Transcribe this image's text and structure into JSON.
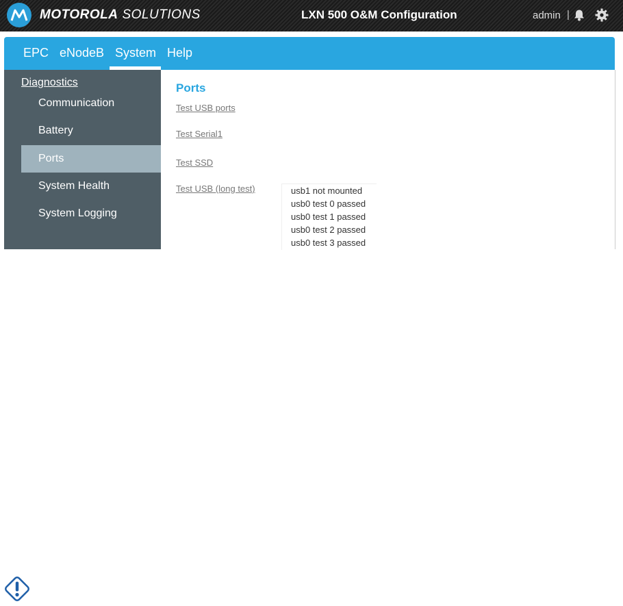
{
  "header": {
    "brand_bold": "MOTOROLA",
    "brand_light": "SOLUTIONS",
    "app_title": "LXN 500 O&M Configuration",
    "user": "admin",
    "separator": "|",
    "icons": [
      "motorola-logo-icon",
      "bell-icon",
      "gear-icon"
    ]
  },
  "nav": {
    "items": [
      {
        "label": "EPC"
      },
      {
        "label": "eNodeB"
      },
      {
        "label": "System"
      },
      {
        "label": "Help"
      }
    ],
    "active": "System"
  },
  "sidebar": {
    "heading": "Diagnostics",
    "items": [
      {
        "label": "Communication"
      },
      {
        "label": "Battery"
      },
      {
        "label": "Ports"
      },
      {
        "label": "System Health"
      },
      {
        "label": "System Logging"
      }
    ],
    "selected": "Ports"
  },
  "content": {
    "title": "Ports",
    "links": [
      {
        "label": "Test USB ports"
      },
      {
        "label": "Test Serial1"
      },
      {
        "label": "Test SSD"
      },
      {
        "label": "Test USB (long test)"
      }
    ],
    "results": [
      "usb1 not mounted",
      "usb0 test 0 passed",
      "usb0 test 1 passed",
      "usb0 test 2 passed",
      "usb0 test 3 passed"
    ]
  },
  "colors": {
    "accent": "#29a6e0",
    "sidebar_bg": "#4f5e66",
    "sidebar_selected": "#9fb3bd",
    "warning_icon": "#1f5fa8"
  },
  "footer": {
    "icon": "warning-icon"
  }
}
